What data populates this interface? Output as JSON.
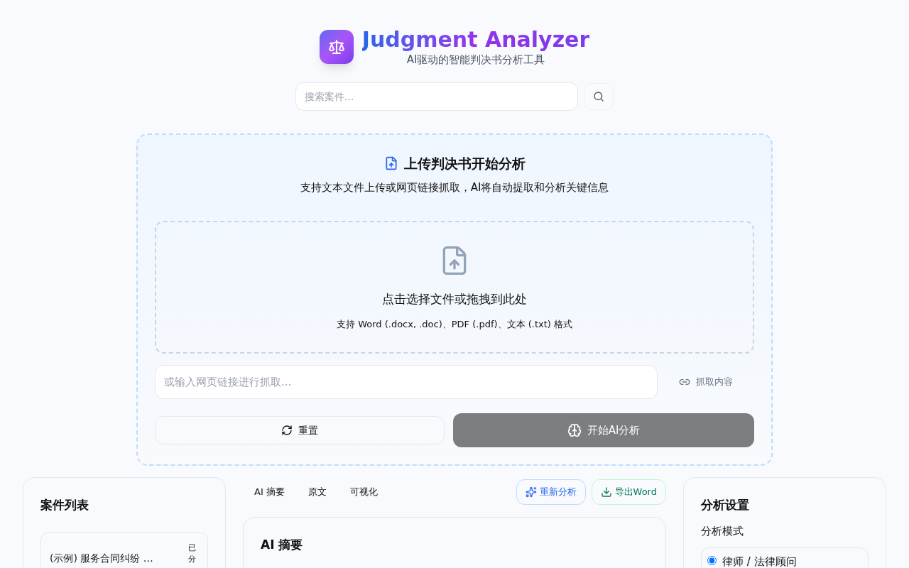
{
  "header": {
    "title": "Judgment Analyzer",
    "subtitle": "AI驱动的智能判决书分析工具"
  },
  "search": {
    "placeholder": "搜索案件..."
  },
  "upload": {
    "title": "上传判决书开始分析",
    "description": "支持文本文件上传或网页链接抓取，AI将自动提取和分析关键信息",
    "dropzone_title": "点击选择文件或拖拽到此处",
    "dropzone_hint": "支持 Word (.docx, .doc)、PDF (.pdf)、文本 (.txt) 格式",
    "url_placeholder": "或输入网页链接进行抓取...",
    "fetch_button": "抓取内容",
    "reset_button": "重置",
    "analyze_button": "开始AI分析",
    "analyze_disabled": true
  },
  "case_list": {
    "title": "案件列表",
    "items": [
      {
        "name": "(示例) 服务合同纠纷 …",
        "status": "已分"
      }
    ]
  },
  "tabs": [
    "AI 摘要",
    "原文",
    "可视化"
  ],
  "actions": {
    "reanalyze": "重新分析",
    "export": "导出Word"
  },
  "summary": {
    "title": "AI 摘要"
  },
  "settings": {
    "title": "分析设置",
    "mode_label": "分析模式",
    "modes": [
      {
        "label": "律师 / 法律顾问",
        "selected": true
      }
    ]
  }
}
